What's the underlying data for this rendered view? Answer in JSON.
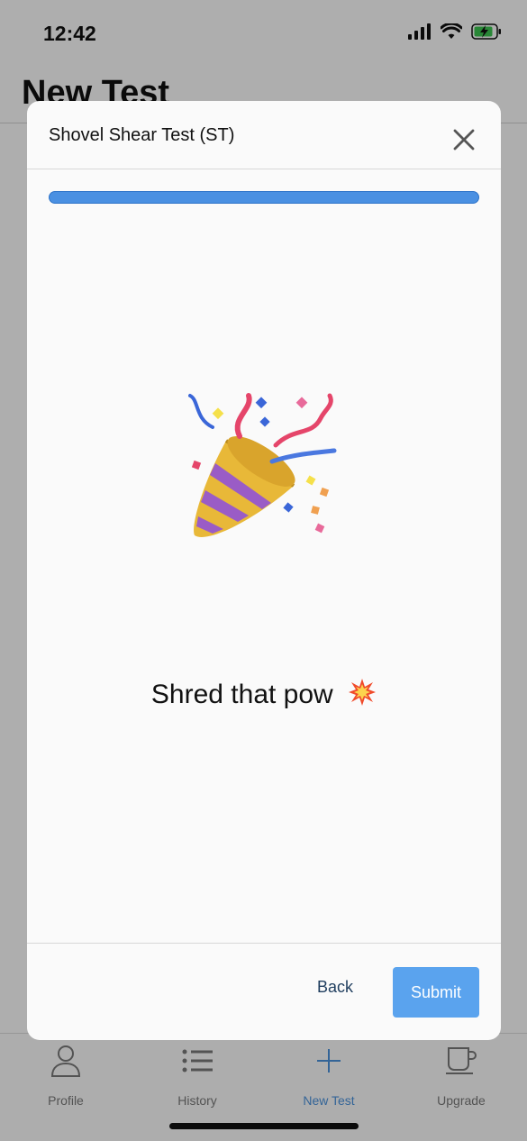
{
  "status_bar": {
    "time": "12:42"
  },
  "page": {
    "title": "New Test"
  },
  "tabs": [
    {
      "label": "Profile",
      "icon": "person-icon",
      "active": false
    },
    {
      "label": "History",
      "icon": "list-icon",
      "active": false
    },
    {
      "label": "New Test",
      "icon": "plus-icon",
      "active": true
    },
    {
      "label": "Upgrade",
      "icon": "cup-icon",
      "active": false
    }
  ],
  "modal": {
    "title": "Shovel Shear Test (ST)",
    "progress": 1.0,
    "illustration": "party-popper-icon",
    "message": "Shred that pow",
    "message_icon": "collision-icon",
    "back_label": "Back",
    "submit_label": "Submit"
  },
  "colors": {
    "accent": "#4a90e2",
    "submit": "#5aa3ee",
    "tab_active": "#4a90d9"
  }
}
